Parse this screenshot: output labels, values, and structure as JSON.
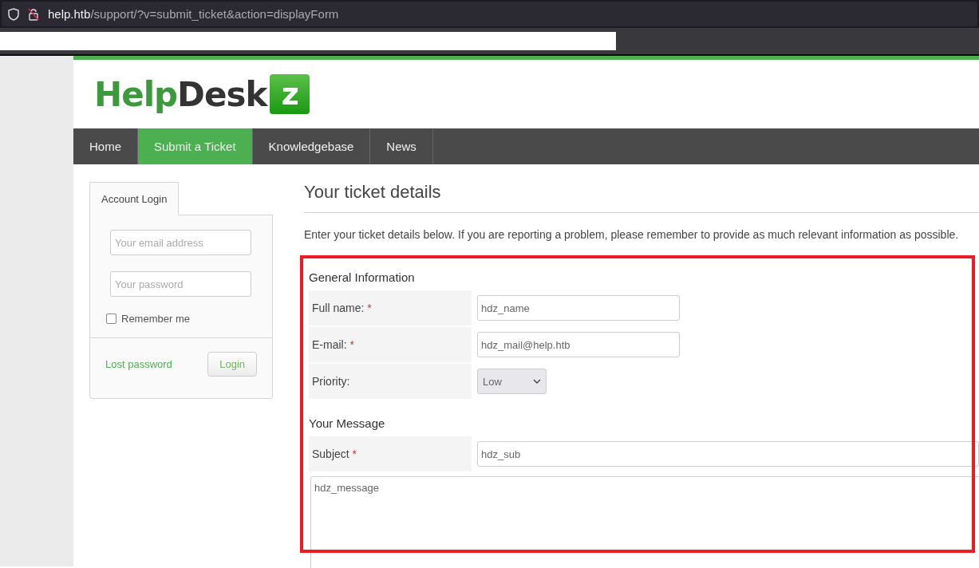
{
  "browser": {
    "url_host": "help.htb",
    "url_path": "/support/?v=submit_ticket&action=displayForm"
  },
  "logo": {
    "part1": "Help",
    "part2": "Desk",
    "badge": "z"
  },
  "nav": [
    {
      "label": "Home",
      "selected": false
    },
    {
      "label": "Submit a Ticket",
      "selected": true
    },
    {
      "label": "Knowledgebase",
      "selected": false
    },
    {
      "label": "News",
      "selected": false
    }
  ],
  "sidebar": {
    "tab": "Account Login",
    "email_placeholder": "Your email address",
    "password_placeholder": "Your password",
    "remember": {
      "label": "Remember me",
      "checked": false
    },
    "lost_password": "Lost password",
    "login_button": "Login"
  },
  "main": {
    "title": "Your ticket details",
    "intro": "Enter your ticket details below. If you are reporting a problem, please remember to provide as much relevant information as possible.",
    "sections": [
      {
        "heading": "General Information",
        "fields": [
          {
            "kind": "text",
            "label": "Full name:",
            "mark": "*",
            "value": "hdz_name"
          },
          {
            "kind": "text",
            "label": "E-mail:",
            "mark": "*",
            "value": "hdz_mail@help.htb"
          },
          {
            "kind": "select",
            "label": "Priority:",
            "value": "Low"
          }
        ]
      },
      {
        "heading": "Your Message",
        "fields": [
          {
            "kind": "wide",
            "label": "Subject",
            "mark": "*",
            "value": "hdz_sub"
          },
          {
            "kind": "textarea",
            "value": "hdz_message"
          }
        ]
      }
    ]
  }
}
